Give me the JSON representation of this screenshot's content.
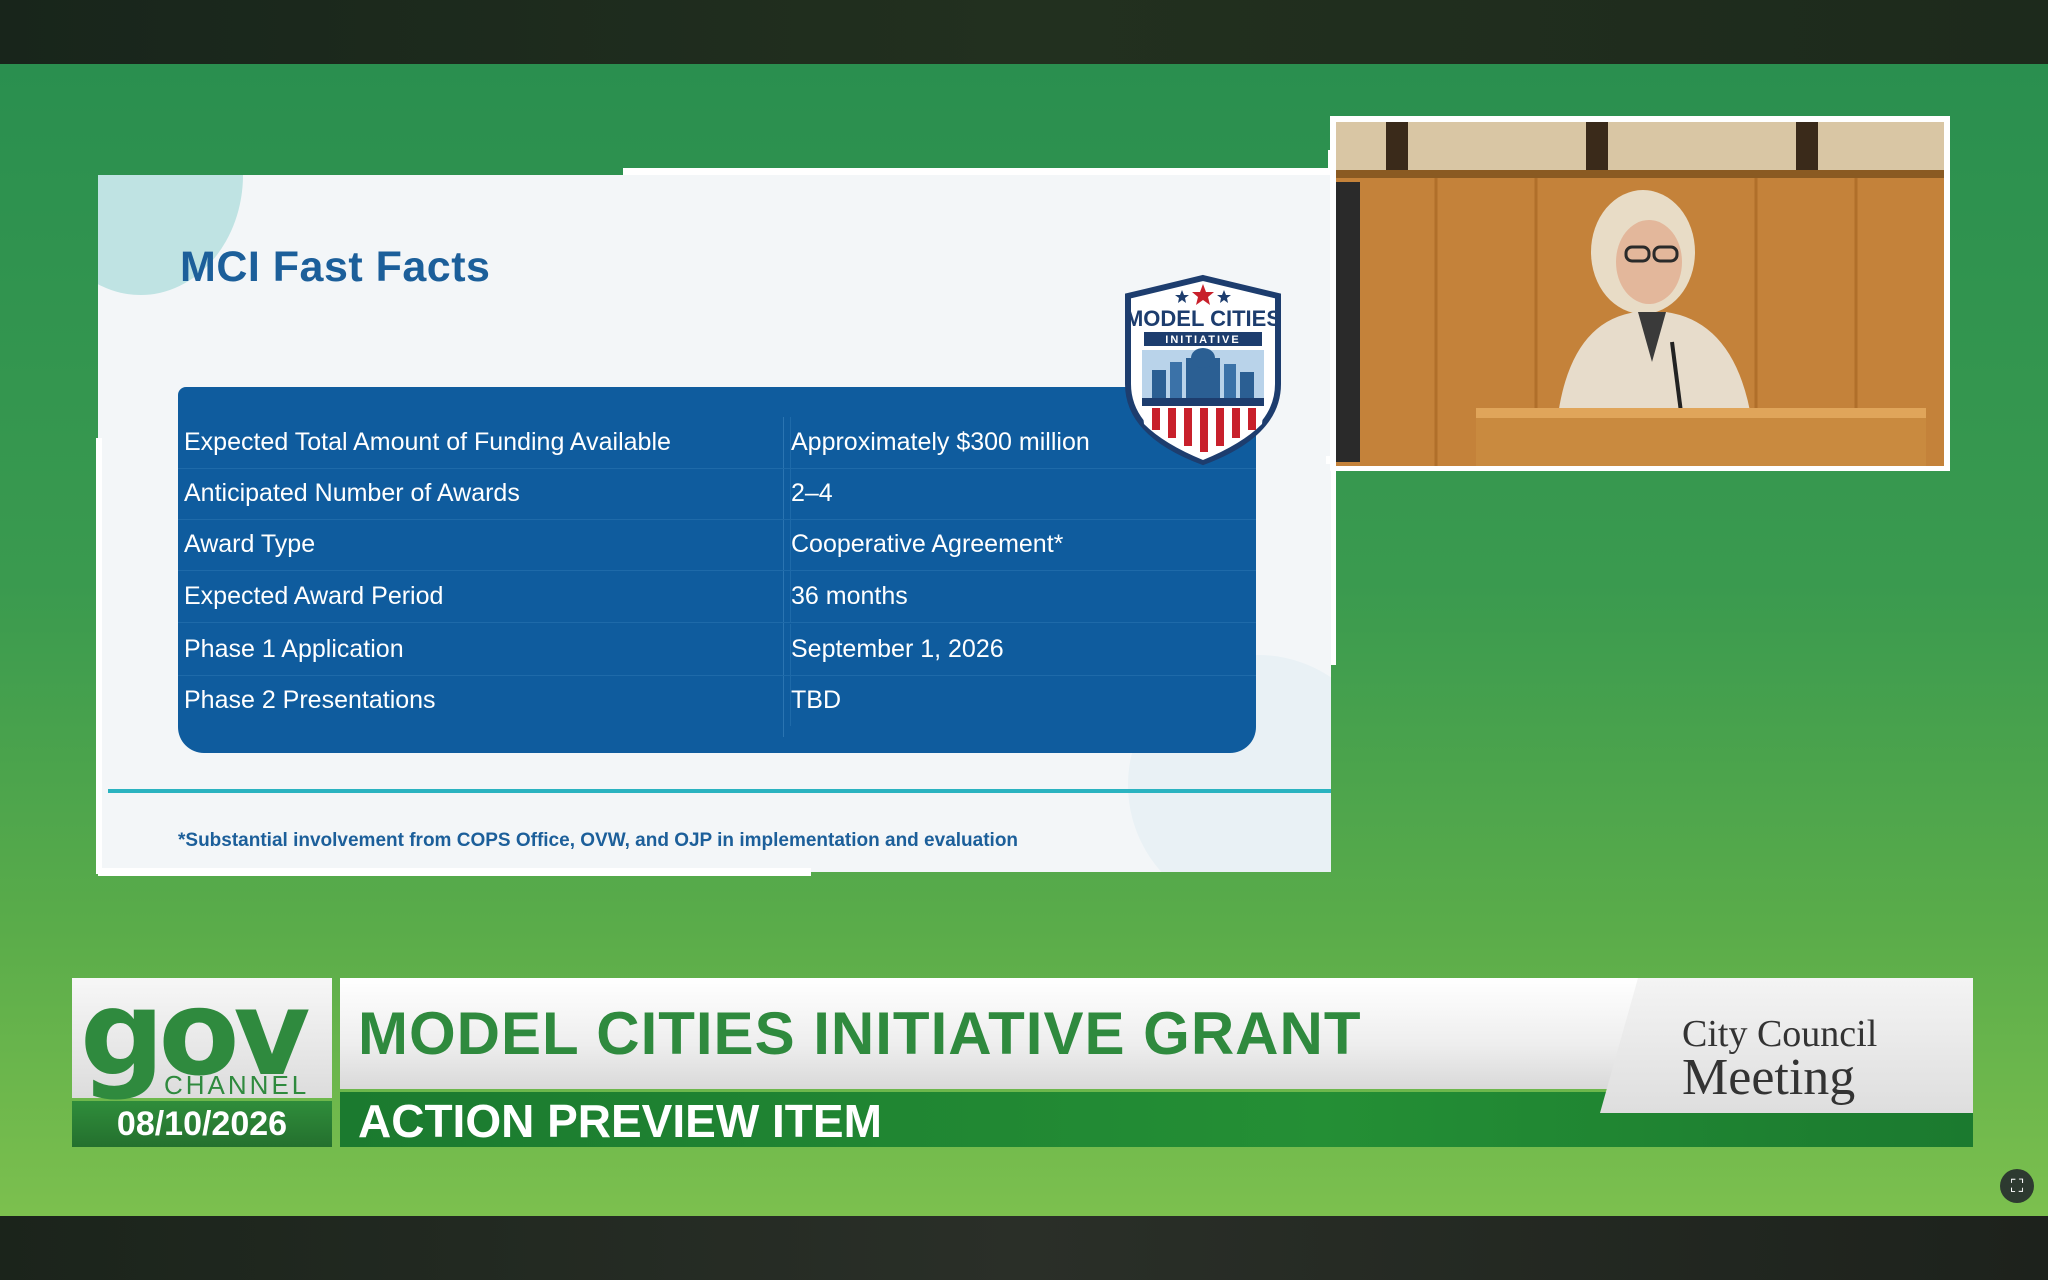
{
  "slide": {
    "title": "MCI Fast Facts",
    "facts": [
      {
        "label": "Expected Total Amount of Funding Available",
        "value": "Approximately $300 million"
      },
      {
        "label": "Anticipated Number of Awards",
        "value": "2–4"
      },
      {
        "label": "Award Type",
        "value": "Cooperative Agreement*"
      },
      {
        "label": "Expected Award Period",
        "value": "36 months"
      },
      {
        "label": "Phase 1 Application",
        "value": "September 1, 2026"
      },
      {
        "label": "Phase 2 Presentations",
        "value": "TBD"
      }
    ],
    "footnote": "*Substantial involvement from COPS Office, OVW, and OJP in implementation and evaluation",
    "badge": {
      "line1": "MODEL CITIES",
      "line2": "INITIATIVE"
    }
  },
  "lower_third": {
    "logo_text": "gov",
    "channel_text": "CHANNEL",
    "date": "08/10/2026",
    "headline": "MODEL CITIES INITIATIVE GRANT",
    "subheadline": "ACTION PREVIEW ITEM",
    "meeting_line1": "City Council",
    "meeting_line2": "Meeting"
  },
  "colors": {
    "slide_title": "#1c5f9a",
    "table_bg": "#0f5c9e",
    "brand_green": "#2f8a3e",
    "background_green": "#3a9a4f"
  },
  "icons": {
    "fullscreen": "screen-capture-icon"
  }
}
